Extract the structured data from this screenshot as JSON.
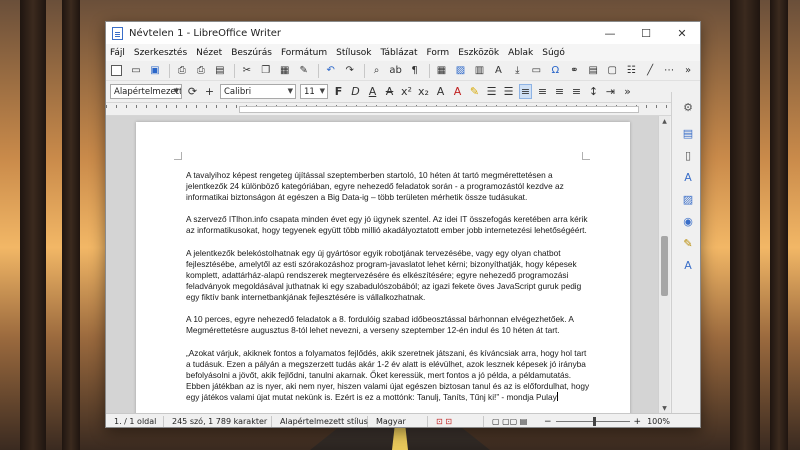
{
  "window": {
    "title": "Névtelen 1 - LibreOffice Writer",
    "controls": {
      "minimize": "—",
      "maximize": "☐",
      "close": "✕"
    }
  },
  "menu": [
    "Fájl",
    "Szerkesztés",
    "Nézet",
    "Beszúrás",
    "Formátum",
    "Stílusok",
    "Táblázat",
    "Form",
    "Eszközök",
    "Ablak",
    "Súgó"
  ],
  "format_bar": {
    "paragraph_style": "Alapértelmezett st",
    "font_name": "Calibri",
    "font_size": "11"
  },
  "document": {
    "paragraphs": [
      "A tavalyihoz képest rengeteg újítással szeptemberben startoló, 10 héten át tartó megmérettetésen a jelentkezők 24 különböző kategóriában, egyre nehezedő feladatok során - a programozástól kezdve az informatikai biztonságon át egészen a Big Data-ig – több területen mérhetik össze tudásukat.",
      "A szervező ITlhon.info csapata minden évet egy jó ügynek szentel. Az idei IT összefogás keretében arra kérik az informatikusokat, hogy tegyenek együtt több millió akadályoztatott ember jobb internetezési lehetőségéért.",
      "A jelentkezők belekóstolhatnak egy új gyártósor egyik robotjának tervezésébe, vagy egy olyan chatbot fejlesztésébe, amelytől az esti szórakozáshoz program-javaslatot lehet kérni; bizonyíthatják, hogy képesek komplett, adattárház-alapú rendszerek megtervezésére és elkészítésére; egyre nehezedő programozási feladványok megoldásával juthatnak ki egy szabadulószobából; az igazi fekete öves JavaScript guruk pedig egy fiktív bank internetbankjának fejlesztésére is vállalkozhatnak.",
      "A 10 perces, egyre nehezedő feladatok a 8. fordulóig szabad időbeosztással bárhonnan elvégezhetőek. A Megmérettetésre augusztus 8-tól lehet nevezni, a verseny szeptember 12-én indul és 10 héten át tart.",
      "„Azokat várjuk, akiknek fontos a folyamatos fejlődés, akik szeretnek játszani, és kíváncsiak arra, hogy hol tart a tudásuk. Ezen a pályán a megszerzett tudás akár 1-2 év alatt is elévülhet, azok lesznek képesek jó irányba befolyásolni a jövőt, akik fejlődni, tanulni akarnak. Őket keressük, mert fontos a jó példa, a példamutatás. Ebben játékban az is nyer, aki nem nyer, hiszen valami újat egészen biztosan tanul és az is előfordulhat, hogy egy játékos valami újat mutat nekünk is. Ezért is ez a mottónk: Tanulj, Taníts, Tűnj ki!” - mondja Pulay"
    ]
  },
  "status": {
    "page": "1. / 1 oldal",
    "words": "245 szó, 1 789 karakter",
    "style": "Alapértelmezett stílus",
    "language": "Magyar",
    "zoom": "100%",
    "zoom_level": 1.0
  },
  "colors": {
    "accent": "#2a66c9",
    "page": "#ffffff",
    "workspace": "#d4d4d4"
  },
  "icons": {
    "sidebar": [
      "gear-icon",
      "properties-icon",
      "page-icon",
      "styles-icon",
      "gallery-icon",
      "navigator-icon",
      "manage-changes-icon",
      "design-icon"
    ]
  }
}
